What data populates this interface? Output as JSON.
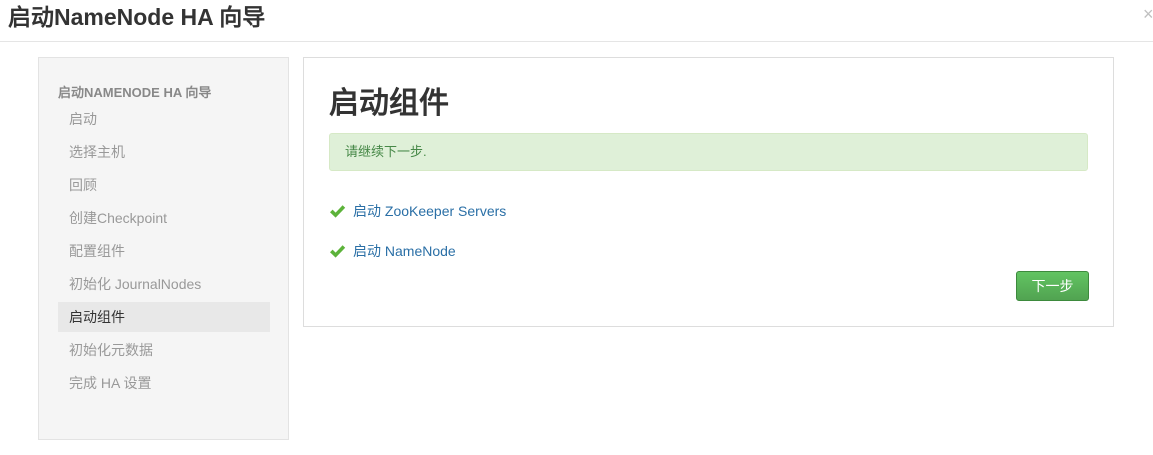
{
  "window": {
    "title": "启动NameNode HA 向导",
    "close_glyph": "×"
  },
  "sidebar": {
    "heading": "启动NAMENODE HA 向导",
    "steps": [
      {
        "label": "启动",
        "active": false
      },
      {
        "label": "选择主机",
        "active": false
      },
      {
        "label": "回顾",
        "active": false
      },
      {
        "label": "创建Checkpoint",
        "active": false
      },
      {
        "label": "配置组件",
        "active": false
      },
      {
        "label": "初始化 JournalNodes",
        "active": false
      },
      {
        "label": "启动组件",
        "active": true
      },
      {
        "label": "初始化元数据",
        "active": false
      },
      {
        "label": "完成 HA 设置",
        "active": false
      }
    ]
  },
  "main": {
    "title": "启动组件",
    "alert_text": "请继续下一步.",
    "tasks": [
      {
        "label": "启动 ZooKeeper Servers",
        "status_icon": "check-icon"
      },
      {
        "label": "启动 NameNode",
        "status_icon": "check-icon"
      }
    ],
    "next_label": "下一步"
  },
  "colors": {
    "success_check": "#5cb33a",
    "link": "#2a6fa6",
    "alert_bg": "#dff0d8",
    "alert_text": "#468847",
    "button_green": "#51a351",
    "active_step_bg": "#e8e8e8"
  }
}
